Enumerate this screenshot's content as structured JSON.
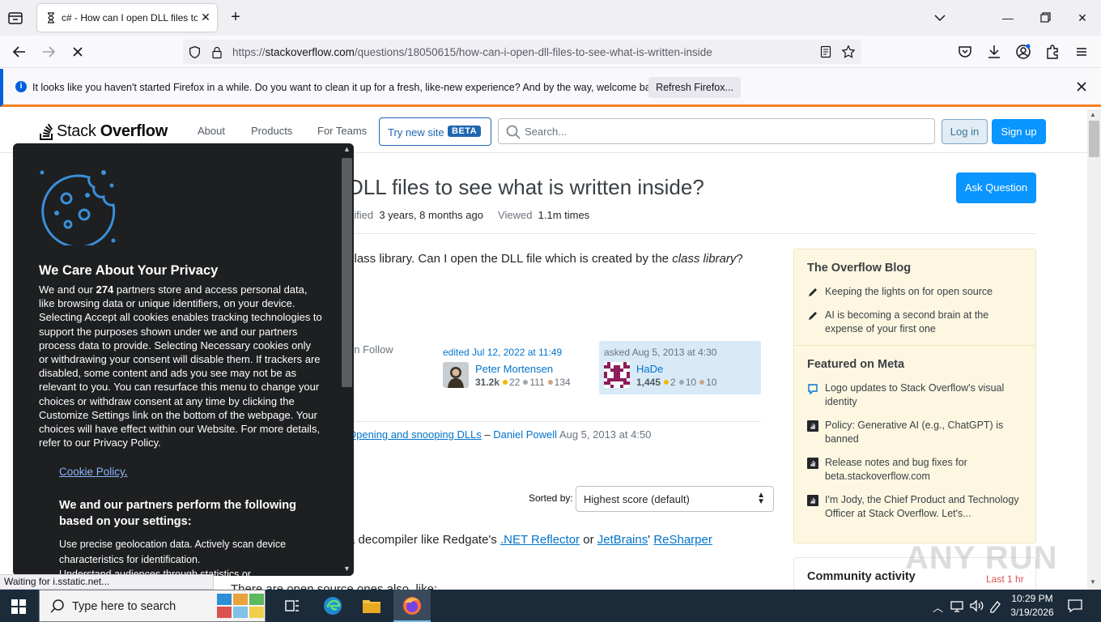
{
  "browser": {
    "tab_title": "c# - How can I open DLL files to see what is written inside",
    "url_host": "stackoverflow.com",
    "url_path": "/questions/18050615/how-can-i-open-dll-files-to-see-what-is-written-inside",
    "url_scheme": "https://",
    "notification_message": "It looks like you haven't started Firefox in a while. Do you want to clean it up for a fresh, like-new experience? And by the way, welcome back!",
    "refresh_button": "Refresh Firefox...",
    "status_text": "Waiting for i.sstatic.net..."
  },
  "header": {
    "logo_light": "Stack ",
    "logo_bold": "Overflow",
    "nav": [
      "About",
      "Products",
      "For Teams"
    ],
    "try_site": "Try new site",
    "beta": "BETA",
    "search_placeholder": "Search...",
    "login": "Log in",
    "signup": "Sign up"
  },
  "question": {
    "title_visible": "DLL files to see what is written inside?",
    "ask_button": "Ask Question",
    "modified_label": "dified",
    "modified_value": "3 years, 8 months ago",
    "viewed_label": "Viewed",
    "viewed_value": "1.1m times",
    "body_prefix": "class library. Can I open the DLL file which is created by the ",
    "body_italic": "class library",
    "body_suffix": "?",
    "actions": "on  Follow",
    "editor": {
      "action": "edited Jul 12, 2022 at 11:49",
      "name": "Peter Mortensen",
      "rep": "31.2k",
      "gold": "22",
      "silver": "111",
      "bronze": "134"
    },
    "asker": {
      "action": "asked Aug 5, 2013 at 4:30",
      "name": "HaDe",
      "rep": "1,445",
      "gold": "2",
      "silver": "10",
      "bronze": "10"
    },
    "comment": {
      "link": "Opening and snooping DLLs",
      "dash": " – ",
      "user": "Daniel Powell",
      "time": " Aug 5, 2013 at 4:50"
    }
  },
  "answers": {
    "sorted_by": "Sorted by:",
    "sort_value": "Highest score (default)",
    "line1_prefix": "a decompiler like Redgate's ",
    "link1": ".NET Reflector",
    "or": " or ",
    "link2": "JetBrains",
    "apos": "' ",
    "link3": "ReSharper",
    "line2": "There are open source ones also, like:"
  },
  "sidebar": {
    "blog_title": "The Overflow Blog",
    "blog_items": [
      "Keeping the lights on for open source",
      "AI is becoming a second brain at the expense of your first one"
    ],
    "meta_title": "Featured on Meta",
    "meta_items": [
      "Logo updates to Stack Overflow's visual identity",
      "Policy: Generative AI (e.g., ChatGPT) is banned",
      "Release notes and bug fixes for beta.stackoverflow.com",
      "I'm Jody, the Chief Product and Technology Officer at Stack Overflow. Let's..."
    ],
    "community_title": "Community activity",
    "community_time": "Last 1 hr"
  },
  "consent": {
    "title": "We Care About Your Privacy",
    "desc_pre": "We and our ",
    "desc_num": "274",
    "desc_post": " partners store and access personal data, like browsing data or unique identifiers, on your device. Selecting Accept all cookies enables tracking technologies to support the purposes shown under we and our partners process data to provide. Selecting Necessary cookies only or withdrawing your consent will disable them. If trackers are disabled, some content and ads you see may not be as relevant to you. You can resurface this menu to change your choices or withdraw consent at any time by clicking the Customize Settings link on the bottom of the webpage. Your choices will have effect within our Website. For more details, refer to our Privacy Policy.",
    "cookie_policy": "Cookie Policy",
    "cookie_policy_dot": ".",
    "partners_header": "We and our partners perform the following based on your settings:",
    "purpose1": "Use precise geolocation data. Actively scan device characteristics for identification.",
    "purpose2": "Understand audiences through statistics or"
  },
  "taskbar": {
    "search_placeholder": "Type here to search",
    "time": "10:29 PM",
    "date": "3/19/2026"
  },
  "watermark": "ANY RUN",
  "colors": {
    "so_orange": "#f48024",
    "so_blue": "#0a95ff",
    "link_blue": "#0074cc",
    "firefox_blue": "#0060df",
    "sidebar_yellow": "#fdf7e2",
    "consent_bg": "#1d1f21",
    "taskbar_bg": "#1c2b3a"
  }
}
